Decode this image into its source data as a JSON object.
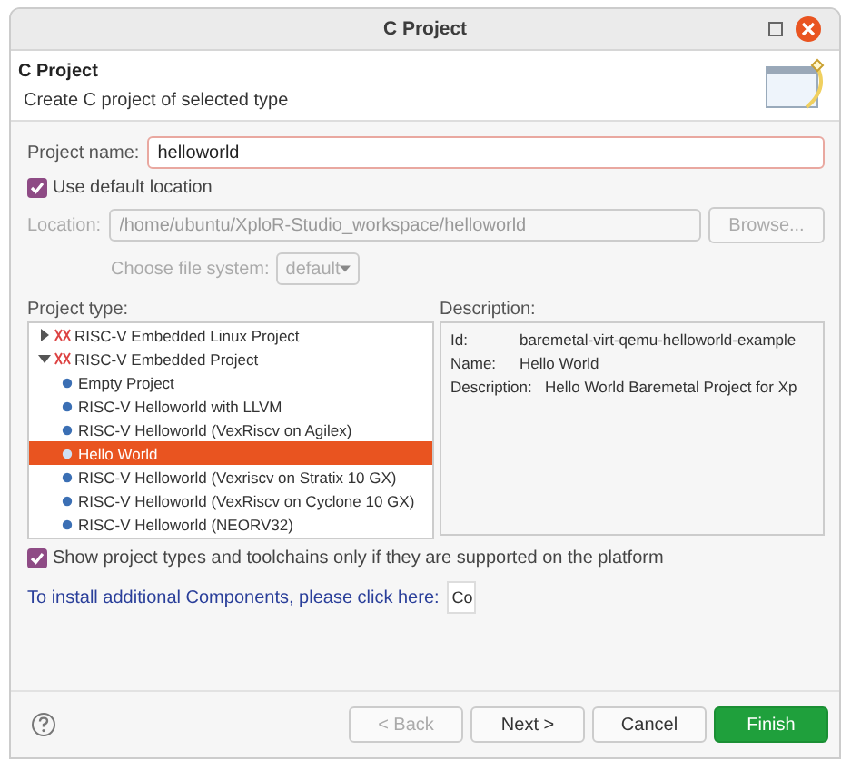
{
  "window": {
    "title": "C Project"
  },
  "header": {
    "title": "C Project",
    "subtitle": "Create C project of selected type"
  },
  "project_name": {
    "label": "Project name:",
    "value": "helloworld"
  },
  "use_default_location": {
    "label": "Use default location",
    "checked": true
  },
  "location": {
    "label": "Location:",
    "value": "/home/ubuntu/XploR-Studio_workspace/helloworld",
    "disabled": true,
    "button": "Browse..."
  },
  "file_system": {
    "label": "Choose file system:",
    "value": "default",
    "disabled": true
  },
  "project_type": {
    "label": "Project type:",
    "items": [
      {
        "label": "RISC-V Embedded Linux Project",
        "expanded": false,
        "selected": false
      },
      {
        "label": "RISC-V Embedded Project",
        "expanded": true,
        "selected": false,
        "children": [
          {
            "label": "Empty Project",
            "selected": false
          },
          {
            "label": "RISC-V Helloworld with LLVM",
            "selected": false
          },
          {
            "label": "RISC-V Helloworld (VexRiscv on Agilex)",
            "selected": false
          },
          {
            "label": "Hello World",
            "selected": true
          },
          {
            "label": "RISC-V Helloworld (Vexriscv on Stratix 10 GX)",
            "selected": false
          },
          {
            "label": "RISC-V Helloworld (VexRiscv on Cyclone 10 GX)",
            "selected": false
          },
          {
            "label": "RISC-V Helloworld (NEORV32)",
            "selected": false
          }
        ]
      }
    ]
  },
  "description": {
    "label": "Description:",
    "rows": [
      {
        "key": "Id:",
        "value": "baremetal-virt-qemu-helloworld-example"
      },
      {
        "key": "Name:",
        "value": "Hello World"
      },
      {
        "key": "Description:",
        "value": "Hello World Baremetal Project for Xp"
      }
    ]
  },
  "show_supported": {
    "label": "Show project types and toolchains only if they are supported on the platform",
    "checked": true
  },
  "install": {
    "label": "To install additional Components, please click here:",
    "button": "Co"
  },
  "buttons": [
    {
      "label": "< Back",
      "kind": "normal",
      "disabled": true
    },
    {
      "label": "Next >",
      "kind": "normal",
      "disabled": false
    },
    {
      "label": "Cancel",
      "kind": "normal",
      "disabled": false
    },
    {
      "label": "Finish",
      "kind": "primary",
      "disabled": false
    }
  ]
}
